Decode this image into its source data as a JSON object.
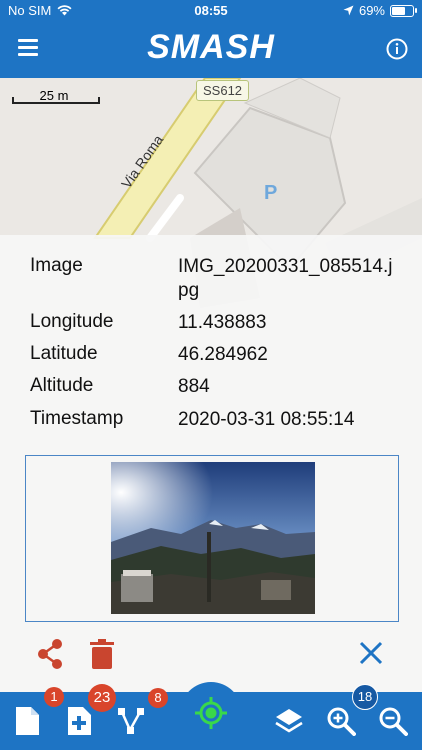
{
  "status_bar": {
    "carrier": "No SIM",
    "time": "08:55",
    "battery": "69%",
    "battery_level": 0.69
  },
  "app_bar": {
    "title": "SMASH",
    "menu_icon": "hamburger-menu-icon",
    "info_icon": "info-icon"
  },
  "map": {
    "scale_label": "25 m",
    "road_label": "SS612",
    "street_label": "Via Roma",
    "parking_label": "P"
  },
  "info_panel": {
    "rows": [
      {
        "key": "Image",
        "value": "IMG_20200331_085514.jpg"
      },
      {
        "key": "Longitude",
        "value": "11.438883"
      },
      {
        "key": "Latitude",
        "value": "46.284962"
      },
      {
        "key": "Altitude",
        "value": "884"
      },
      {
        "key": "Timestamp",
        "value": "2020-03-31 08:55:14"
      }
    ],
    "actions": {
      "share_icon": "share-icon",
      "delete_icon": "trash-icon",
      "close_icon": "close-icon"
    },
    "colors": {
      "share": "#c9452f",
      "delete": "#c9452f",
      "close": "#1e74c4"
    }
  },
  "toolbar": {
    "notes_badge": "1",
    "add_badge": "23",
    "gps_log_badge": "8",
    "zoom_badge": "18"
  },
  "colors": {
    "primary": "#1e74c4",
    "badge_red": "#d9452b",
    "gps_green": "#39d84a"
  }
}
